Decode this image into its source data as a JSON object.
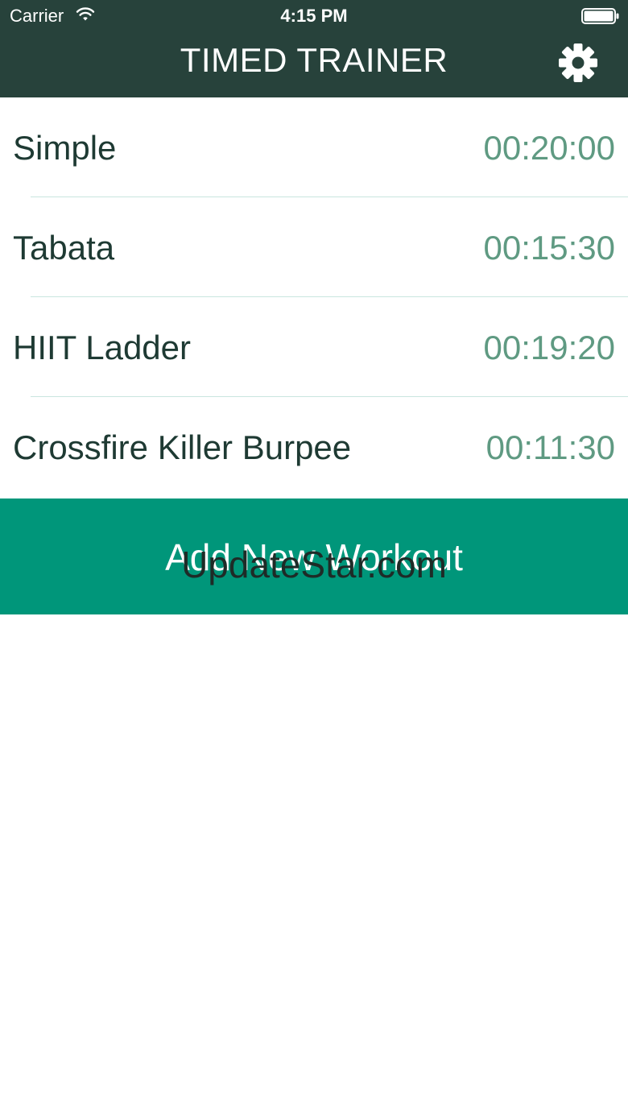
{
  "status_bar": {
    "carrier": "Carrier",
    "time": "4:15 PM",
    "wifi_icon": "wifi-icon",
    "battery_icon": "battery-icon"
  },
  "header": {
    "title": "TIMED TRAINER",
    "settings_icon": "gear-icon",
    "background_color": "#27423b"
  },
  "workouts": [
    {
      "name": "Simple",
      "duration": "00:20:00"
    },
    {
      "name": "Tabata",
      "duration": "00:15:30"
    },
    {
      "name": "HIIT Ladder",
      "duration": "00:19:20"
    },
    {
      "name": "Crossfire Killer Burpee",
      "duration": "00:11:30"
    }
  ],
  "add_button": {
    "label": "Add New Workout",
    "background_color": "#00967a"
  },
  "watermark": "UpdateStar.com",
  "colors": {
    "name_text": "#1e3a33",
    "duration_text": "#5f9a82",
    "divider": "#c9e6df"
  }
}
